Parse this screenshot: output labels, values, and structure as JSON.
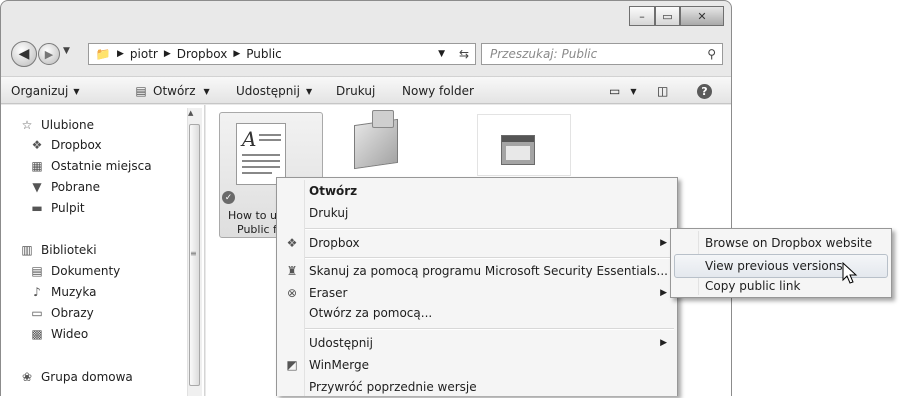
{
  "address": {
    "crumbs": [
      "piotr",
      "Dropbox",
      "Public"
    ],
    "search_placeholder": "Przeszukaj: Public"
  },
  "toolbar": {
    "organize": "Organizuj",
    "open": "Otwórz",
    "share": "Udostępnij",
    "print": "Drukuj",
    "new_folder": "Nowy folder"
  },
  "nav": {
    "favorites": {
      "label": "Ulubione",
      "items": [
        "Dropbox",
        "Ostatnie miejsca",
        "Pobrane",
        "Pulpit"
      ]
    },
    "libraries": {
      "label": "Biblioteki",
      "items": [
        "Dokumenty",
        "Muzyka",
        "Obrazy",
        "Wideo"
      ]
    },
    "homegroup": "Grupa domowa"
  },
  "files": [
    {
      "name_line1": "How to u",
      "name_line2": "Public f"
    }
  ],
  "context_menu": [
    {
      "label": "Otwórz",
      "bold": true
    },
    {
      "label": "Drukuj"
    },
    {
      "label": "Dropbox",
      "submenu": true,
      "icon": "dropbox-icon"
    },
    {
      "label": "Skanuj za pomocą programu Microsoft Security Essentials...",
      "icon": "scan-icon"
    },
    {
      "label": "Eraser",
      "submenu": true,
      "icon": "eraser-icon"
    },
    {
      "label": "Otwórz za pomocą..."
    },
    {
      "label": "Udostępnij",
      "submenu": true
    },
    {
      "label": "WinMerge",
      "icon": "winmerge-icon"
    },
    {
      "label": "Przywróć poprzednie wersje"
    }
  ],
  "dropbox_submenu": [
    {
      "label": "Browse on Dropbox website"
    },
    {
      "label": "View previous versions",
      "highlighted": true
    },
    {
      "label": "Copy public link"
    }
  ],
  "colors": {
    "highlight_border": "#b8c0c9",
    "menu_bg": "#f5f5f5",
    "frame": "#e9e9e9"
  }
}
